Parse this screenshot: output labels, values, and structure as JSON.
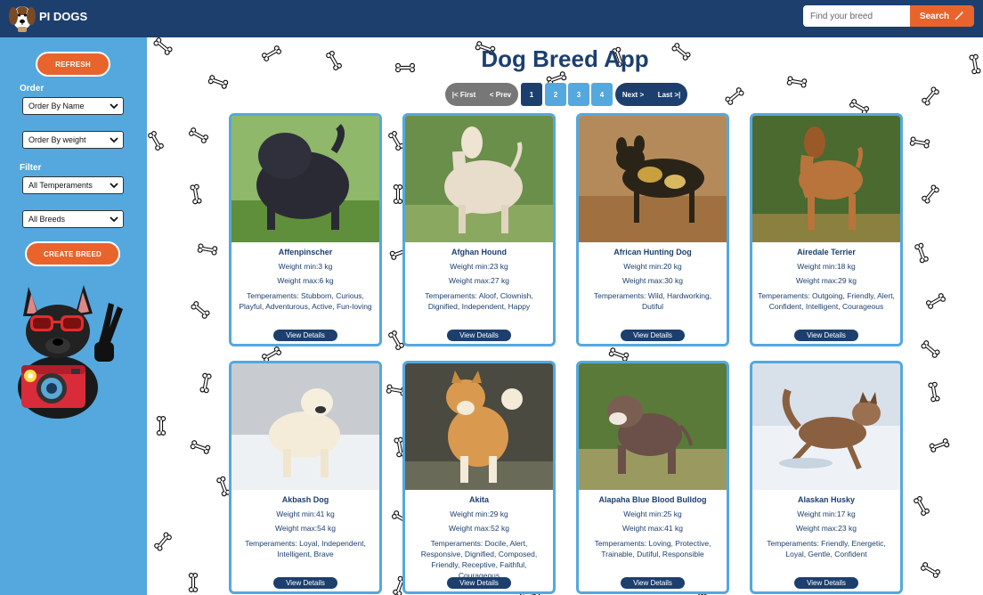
{
  "header": {
    "brand": "PI DOGS",
    "search_placeholder": "Find your breed",
    "search_label": "Search"
  },
  "sidebar": {
    "refresh_label": "REFRESH",
    "order_heading": "Order",
    "order_by_name": "Order By Name",
    "order_by_weight": "Order By weight",
    "filter_heading": "Filter",
    "temperaments_filter": "All Temperaments",
    "breeds_filter": "All Breeds",
    "create_label": "CREATE BREED"
  },
  "main": {
    "title": "Dog Breed App",
    "pagination": {
      "first": "|< First",
      "prev": "< Prev",
      "pages": [
        "1",
        "2",
        "3",
        "4"
      ],
      "current_page": "1",
      "next": "Next >",
      "last": "Last >|"
    },
    "view_label": "View Details",
    "cards": [
      {
        "name": "Affenpinscher",
        "weight_min": "Weight min:3 kg",
        "weight_max": "Weight max:6 kg",
        "temperaments": "Temperaments: Stubborn, Curious, Playful, Adventurous, Active, Fun-loving"
      },
      {
        "name": "Afghan Hound",
        "weight_min": "Weight min:23 kg",
        "weight_max": "Weight max:27 kg",
        "temperaments": "Temperaments: Aloof, Clownish, Dignified, Independent, Happy"
      },
      {
        "name": "African Hunting Dog",
        "weight_min": "Weight min:20 kg",
        "weight_max": "Weight max:30 kg",
        "temperaments": "Temperaments: Wild, Hardworking, Dutiful"
      },
      {
        "name": "Airedale Terrier",
        "weight_min": "Weight min:18 kg",
        "weight_max": "Weight max:29 kg",
        "temperaments": "Temperaments: Outgoing, Friendly, Alert, Confident, Intelligent, Courageous"
      },
      {
        "name": "Akbash Dog",
        "weight_min": "Weight min:41 kg",
        "weight_max": "Weight max:54 kg",
        "temperaments": "Temperaments: Loyal, Independent, Intelligent, Brave"
      },
      {
        "name": "Akita",
        "weight_min": "Weight min:29 kg",
        "weight_max": "Weight max:52 kg",
        "temperaments": "Temperaments: Docile, Alert, Responsive, Dignified, Composed, Friendly, Receptive, Faithful, Courageous"
      },
      {
        "name": "Alapaha Blue Blood Bulldog",
        "weight_min": "Weight min:25 kg",
        "weight_max": "Weight max:41 kg",
        "temperaments": "Temperaments: Loving, Protective, Trainable, Dutiful, Responsible"
      },
      {
        "name": "Alaskan Husky",
        "weight_min": "Weight min:17 kg",
        "weight_max": "Weight max:23 kg",
        "temperaments": "Temperaments: Friendly, Energetic, Loyal, Gentle, Confident"
      }
    ]
  },
  "colors": {
    "navy": "#1c3f6e",
    "sky": "#55a8dd",
    "orange": "#e8642c"
  },
  "icons": [
    "dog-logo-icon",
    "magic-wand-icon",
    "chevron-down-icon",
    "bone-icon"
  ]
}
